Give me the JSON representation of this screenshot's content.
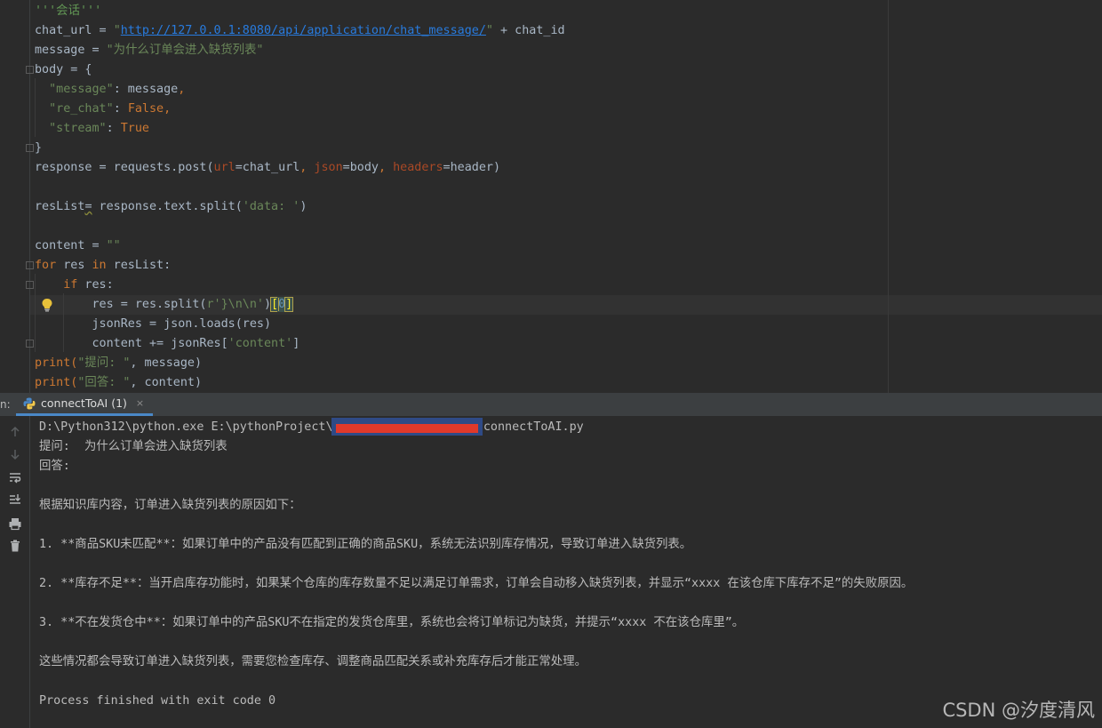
{
  "editor": {
    "code_lines": [
      [
        {
          "t": "'''会话'''",
          "c": "doc"
        }
      ],
      [
        {
          "t": "chat_url = ",
          "c": ""
        },
        {
          "t": "\"",
          "c": "str"
        },
        {
          "t": "http://127.0.0.1:8080/api/application/chat_message/",
          "c": "link"
        },
        {
          "t": "\"",
          "c": "str"
        },
        {
          "t": " + chat_id",
          "c": ""
        }
      ],
      [
        {
          "t": "message = ",
          "c": ""
        },
        {
          "t": "\"为什么订单会进入缺货列表\"",
          "c": "str"
        }
      ],
      [
        {
          "t": "body = {",
          "c": ""
        }
      ],
      [
        {
          "t": "  ",
          "c": ""
        },
        {
          "t": "\"message\"",
          "c": "str"
        },
        {
          "t": ": message",
          "c": ""
        },
        {
          "t": ",",
          "c": "kw"
        }
      ],
      [
        {
          "t": "  ",
          "c": ""
        },
        {
          "t": "\"re_chat\"",
          "c": "str"
        },
        {
          "t": ": ",
          "c": ""
        },
        {
          "t": "False",
          "c": "kw"
        },
        {
          "t": ",",
          "c": "kw"
        }
      ],
      [
        {
          "t": "  ",
          "c": ""
        },
        {
          "t": "\"stream\"",
          "c": "str"
        },
        {
          "t": ": ",
          "c": ""
        },
        {
          "t": "True",
          "c": "kw"
        }
      ],
      [
        {
          "t": "}",
          "c": ""
        }
      ],
      [
        {
          "t": "response = requests.post(",
          "c": ""
        },
        {
          "t": "url",
          "c": "param"
        },
        {
          "t": "=chat_url",
          "c": ""
        },
        {
          "t": ", ",
          "c": "kw"
        },
        {
          "t": "json",
          "c": "param"
        },
        {
          "t": "=body",
          "c": ""
        },
        {
          "t": ", ",
          "c": "kw"
        },
        {
          "t": "headers",
          "c": "param"
        },
        {
          "t": "=header)",
          "c": ""
        }
      ],
      [],
      [
        {
          "t": "resList",
          "c": ""
        },
        {
          "t": "=",
          "c": "squiggle"
        },
        {
          "t": " response.text.split(",
          "c": ""
        },
        {
          "t": "'data: '",
          "c": "str"
        },
        {
          "t": ")",
          "c": ""
        }
      ],
      [],
      [
        {
          "t": "content = ",
          "c": ""
        },
        {
          "t": "\"\"",
          "c": "str"
        }
      ],
      [
        {
          "t": "for",
          "c": "kw"
        },
        {
          "t": " res ",
          "c": ""
        },
        {
          "t": "in",
          "c": "kw"
        },
        {
          "t": " resList:",
          "c": ""
        }
      ],
      [
        {
          "t": "    ",
          "c": ""
        },
        {
          "t": "if",
          "c": "kw"
        },
        {
          "t": " res:",
          "c": ""
        }
      ],
      [
        {
          "t": "        res = res.split(",
          "c": ""
        },
        {
          "t": "r'}\\n\\n'",
          "c": "str"
        },
        {
          "t": ")",
          "c": ""
        },
        {
          "t": "[",
          "c": "brace-hl"
        },
        {
          "t": "0",
          "c": "num-hl"
        },
        {
          "t": "]",
          "c": "brace-hl"
        }
      ],
      [
        {
          "t": "        jsonRes = json.loads(res)",
          "c": ""
        }
      ],
      [
        {
          "t": "        content += jsonRes[",
          "c": ""
        },
        {
          "t": "'content'",
          "c": "str"
        },
        {
          "t": "]",
          "c": ""
        }
      ],
      [
        {
          "t": "print(",
          "c": "kw"
        },
        {
          "t": "\"提问: \"",
          "c": "str"
        },
        {
          "t": ", message)",
          "c": ""
        }
      ],
      [
        {
          "t": "print(",
          "c": "kw"
        },
        {
          "t": "\"回答: \"",
          "c": "str"
        },
        {
          "t": ", content)",
          "c": ""
        }
      ]
    ]
  },
  "run_panel": {
    "side_label": "n:",
    "tab_label": "connectToAI (1)",
    "tab_close": "×",
    "python_icon": "python-icon",
    "toolbar_icons": [
      "arrow-up-icon",
      "arrow-down-icon",
      "soft-wrap-icon",
      "scroll-to-end-icon",
      "print-icon",
      "trash-icon"
    ]
  },
  "console": {
    "lines": [
      "D:\\Python312\\python.exe E:\\pythonProject\\                    \\connectToAI.py",
      "提问:  为什么订单会进入缺货列表",
      "回答:",
      "",
      "根据知识库内容，订单进入缺货列表的原因如下：",
      "",
      "1. **商品SKU未匹配**：如果订单中的产品没有匹配到正确的商品SKU，系统无法识别库存情况，导致订单进入缺货列表。",
      "",
      "2. **库存不足**：当开启库存功能时，如果某个仓库的库存数量不足以满足订单需求，订单会自动移入缺货列表，并显示“xxxx 在该仓库下库存不足”的失败原因。",
      "",
      "3. **不在发货仓中**：如果订单中的产品SKU不在指定的发货仓库里，系统也会将订单标记为缺货，并提示“xxxx 不在该仓库里”。",
      "",
      "这些情况都会导致订单进入缺货列表，需要您检查库存、调整商品匹配关系或补充库存后才能正常处理。",
      "",
      "Process finished with exit code 0"
    ]
  },
  "watermark": "CSDN @汐度清风",
  "colors": {
    "keyword": "#cc7832",
    "string": "#6a8759",
    "param": "#aa4926",
    "number": "#6897bb",
    "link": "#287bde",
    "accent": "#4a88c7"
  }
}
